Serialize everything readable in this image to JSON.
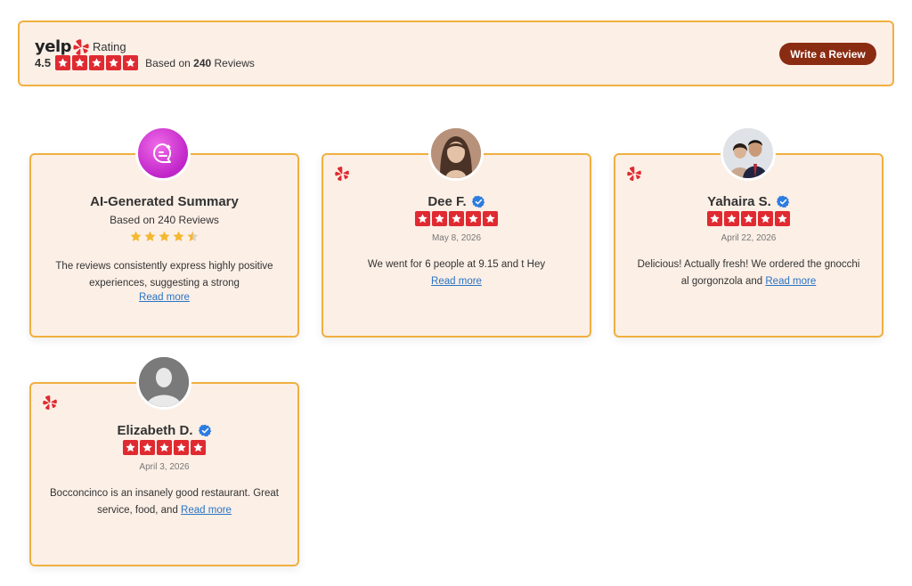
{
  "header": {
    "brand": "yelp",
    "rating_word": "Rating",
    "score": "4.5",
    "based_prefix": "Based on",
    "review_count": "240",
    "reviews_word": "Reviews",
    "write_button": "Write a Review"
  },
  "colors": {
    "accent_border": "#f0b040",
    "card_bg": "#fcefe6",
    "yelp_red": "#e02a31",
    "button_bg": "#8a2c12",
    "link": "#2a74c4",
    "ai_icon": "#d23fd6",
    "verified": "#2d7de0",
    "summary_star": "#f5b82e"
  },
  "summary": {
    "title": "AI-Generated Summary",
    "based": "Based on 240 Reviews",
    "stars": 4.5,
    "text": "The reviews consistently express highly positive experiences, suggesting a strong",
    "read_more": "Read more",
    "icon": "chat-sparkle-icon"
  },
  "reviews": [
    {
      "name": "Dee F.",
      "stars": 5,
      "date": "May 8, 2026",
      "text": "We went for 6 people at 9.15 and t Hey",
      "read_more": "Read more"
    },
    {
      "name": "Yahaira S.",
      "stars": 5,
      "date": "April 22, 2026",
      "text": "Delicious! Actually fresh! We ordered the gnocchi al gorgonzola and",
      "read_more": "Read more"
    },
    {
      "name": "Elizabeth D.",
      "stars": 5,
      "date": "April 3, 2026",
      "text": "Bocconcinco is an insanely good restaurant. Great service, food, and",
      "read_more": "Read more"
    }
  ]
}
